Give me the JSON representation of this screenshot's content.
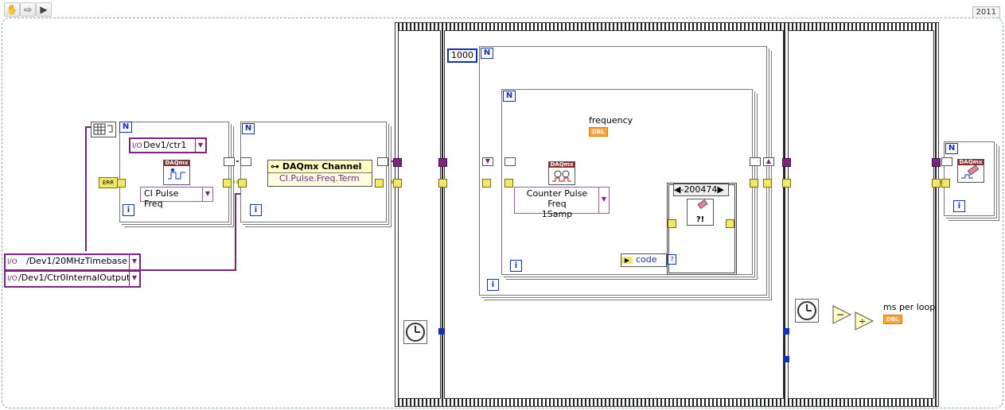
{
  "toolbar": {
    "version": "2011",
    "icons": [
      "hand-icon",
      "arrow-icon",
      "run-icon"
    ]
  },
  "constants": {
    "counter_channel": "Dev1/ctr1",
    "timebase_source": "/Dev1/20MHzTimebase",
    "gate_source": "/Dev1/Ctr0InternalOutput",
    "loop_count": "1000",
    "io_icon": "I/O"
  },
  "nodes": {
    "create_channel_type": "CI Pulse Freq",
    "property_node_title": "DAQmx Channel",
    "property_node_item": "CI.Pulse.Freq.Term",
    "read_type_line1": "Counter Pulse Freq",
    "read_type_line2": "1Samp",
    "daqmx_label": "DAQmx",
    "error_case": "-200474",
    "error_case_glyph": "?!",
    "unbundle_item": "code"
  },
  "indicators": {
    "frequency_label": "frequency",
    "ms_per_loop_label": "ms per loop",
    "dbl": "DBL"
  },
  "terminals": {
    "n": "N",
    "i": "i",
    "q": "?"
  },
  "colors": {
    "refnum_wire": "#7a2480",
    "error_wire": "#c9b400",
    "numeric_wire": "#1030c0",
    "indicator": "#ffa438"
  }
}
